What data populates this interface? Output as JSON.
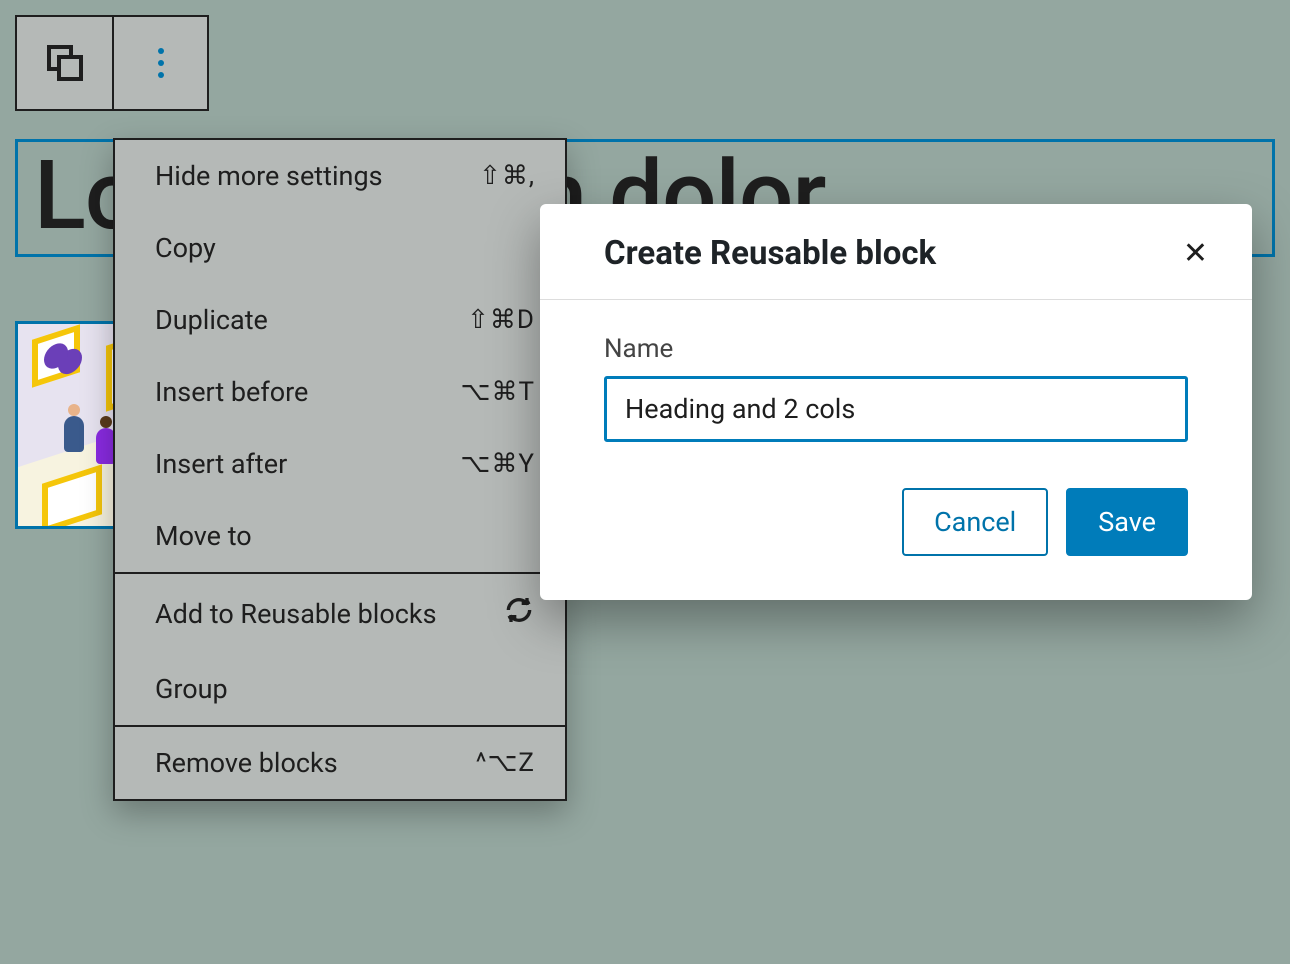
{
  "toolbar": {
    "copy_btn": "copy",
    "more_btn": "more"
  },
  "heading": "Lorem ipsum dolor",
  "menu": {
    "sections": [
      [
        {
          "label": "Hide more settings",
          "shortcut": "⇧⌘,"
        },
        {
          "label": "Copy",
          "shortcut": ""
        },
        {
          "label": "Duplicate",
          "shortcut": "⇧⌘D"
        },
        {
          "label": "Insert before",
          "shortcut": "⌥⌘T"
        },
        {
          "label": "Insert after",
          "shortcut": "⌥⌘Y"
        },
        {
          "label": "Move to",
          "shortcut": ""
        }
      ],
      [
        {
          "label": "Add to Reusable blocks",
          "icon": "reuse"
        },
        {
          "label": "Group",
          "shortcut": ""
        }
      ],
      [
        {
          "label": "Remove blocks",
          "shortcut": "^⌥Z"
        }
      ]
    ]
  },
  "modal": {
    "title": "Create Reusable block",
    "field_label": "Name",
    "name_value": "Heading and 2 cols",
    "cancel": "Cancel",
    "save": "Save"
  }
}
